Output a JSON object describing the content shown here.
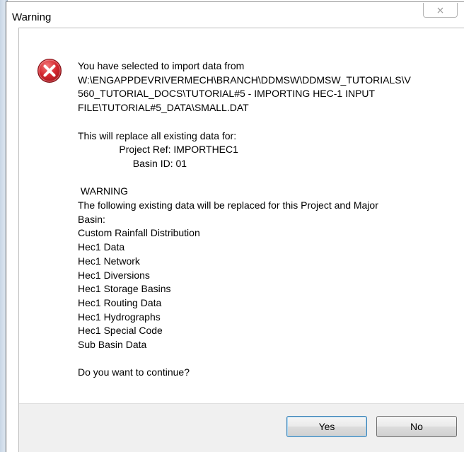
{
  "dialog": {
    "title": "Warning",
    "close_glyph": "⨯",
    "icon": "error-icon",
    "message_lines": [
      "You have selected to import data from",
      "W:\\ENGAPPDEVRIVERMECH\\BRANCH\\DDMSW\\DDMSW_TUTORIALS\\V",
      "560_TUTORIAL_DOCS\\TUTORIAL#5 - IMPORTING HEC-1 INPUT",
      "FILE\\TUTORIAL#5_DATA\\SMALL.DAT",
      "",
      "This will replace all existing data for:",
      "               Project Ref: IMPORTHEC1",
      "                    Basin ID: 01",
      "",
      " WARNING",
      "The following existing data will be replaced for this Project and Major",
      "Basin:",
      "Custom Rainfall Distribution",
      "Hec1 Data",
      "Hec1 Network",
      "Hec1 Diversions",
      "Hec1 Storage Basins",
      "Hec1 Routing Data",
      "Hec1 Hydrographs",
      "Hec1 Special Code",
      "Sub Basin Data",
      "",
      "Do you want to continue?"
    ],
    "buttons": {
      "yes_label": "Yes",
      "no_label": "No"
    }
  },
  "colors": {
    "error_red": "#c8202b",
    "footer_bg": "#f0f0f0",
    "default_button_border": "#3c7fb1"
  }
}
